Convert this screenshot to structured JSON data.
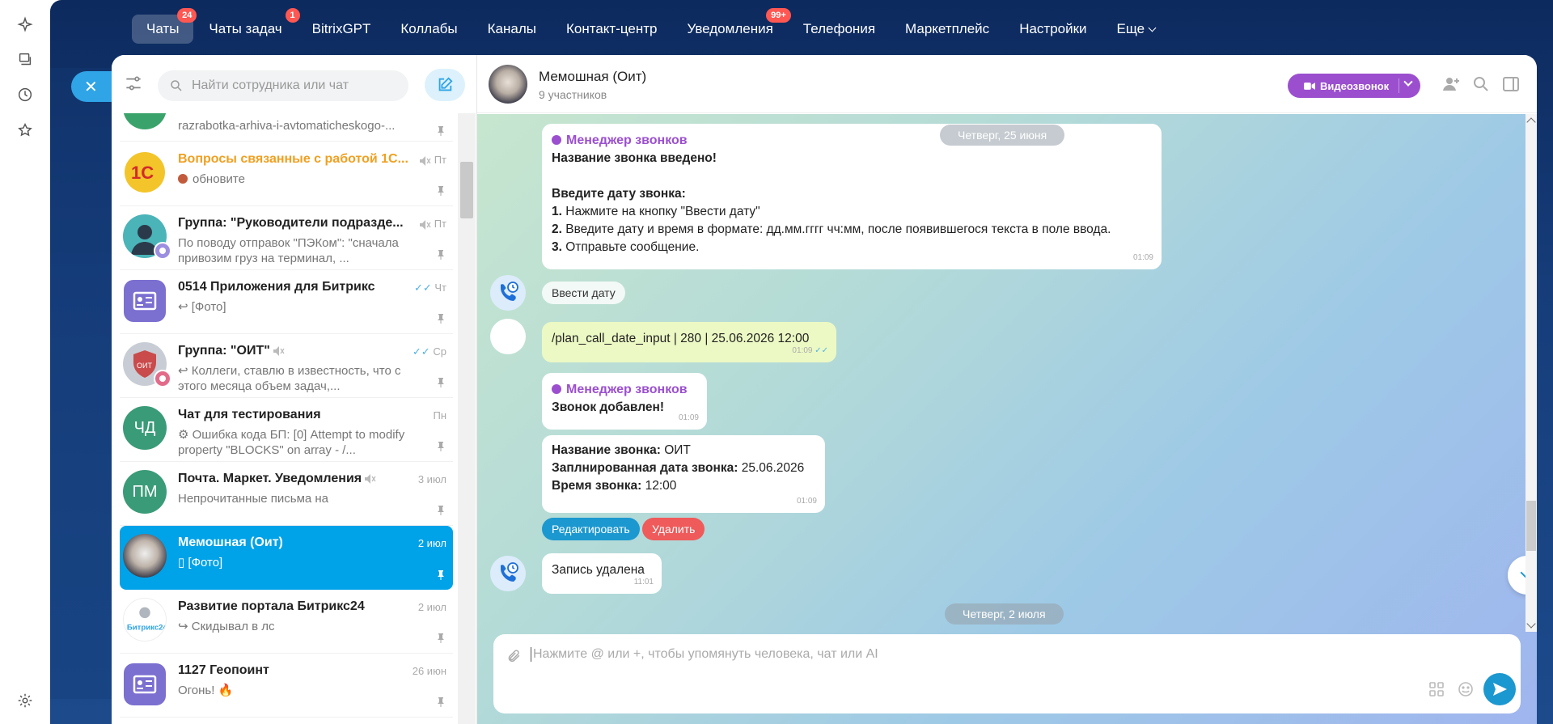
{
  "nav": {
    "items": [
      {
        "label": "Чаты",
        "badge": "24",
        "active": true
      },
      {
        "label": "Чаты задач",
        "badge": "1"
      },
      {
        "label": "BitrixGPT"
      },
      {
        "label": "Коллабы"
      },
      {
        "label": "Каналы"
      },
      {
        "label": "Контакт-центр"
      },
      {
        "label": "Уведомления",
        "badge": "99+"
      },
      {
        "label": "Телефония"
      },
      {
        "label": "Маркетплейс"
      },
      {
        "label": "Настройки"
      },
      {
        "label": "Еще"
      }
    ]
  },
  "rail": {
    "icons": [
      "sparkle-icon",
      "layers-icon",
      "clock-icon",
      "star-icon",
      "gear-icon"
    ]
  },
  "sidebar": {
    "search_placeholder": "Найти сотрудника или чат",
    "chats": [
      {
        "title": "",
        "preview": "razrabotka-arhiva-i-avtomaticheskogo-...",
        "time": "",
        "avatar_color": "#3aa36b"
      },
      {
        "title": "Вопросы связанные с работой 1С...",
        "preview": "обновите",
        "time": "Пт",
        "title_color": "#f0a020",
        "avatar_label": "1С",
        "avatar_color": "#e9c03a",
        "muted": true
      },
      {
        "title": "Группа: \"Руководители подразде...",
        "preview": "По поводу отправок \"ПЭКом\": \"сначала привозим груз на терминал, ...",
        "time": "Пт",
        "avatar_color": "#4ab4b8",
        "muted": true
      },
      {
        "title": "0514 Приложения для Битрикс",
        "preview": "[Фото]",
        "time": "Чт",
        "avatar_color": "#7b6fd0"
      },
      {
        "title": "Группа: \"ОИТ\"",
        "preview": "Коллеги, ставлю в известность, что с этого месяца объем задач,...",
        "time": "Ср",
        "avatar_color": "#c95050",
        "muted": true
      },
      {
        "title": "Чат для тестирования",
        "preview": "Ошибка кода БП: [0] Attempt to modify property \"BLOCKS\" on array - /...",
        "time": "Пн",
        "avatar_label": "ЧД",
        "avatar_color": "#3a9b78"
      },
      {
        "title": "Почта. Маркет. Уведомления",
        "preview": "Непрочитанные письма на",
        "time": "3 июл",
        "avatar_label": "ПМ",
        "avatar_color": "#3a9b78",
        "muted": true
      },
      {
        "title": "Мемошная (Оит)",
        "preview": "[Фото]",
        "time": "2 июл",
        "selected": true
      },
      {
        "title": "Развитие портала Битрикс24",
        "preview": "Скидывал в лс",
        "time": "2 июл",
        "avatar_label": "Битрикс24",
        "avatar_color": "#ffffff"
      },
      {
        "title": "1127 Геопоинт",
        "preview": "Огонь! 🔥",
        "time": "26 июн",
        "avatar_color": "#7b6fd0"
      }
    ]
  },
  "chat": {
    "title": "Мемошная (Оит)",
    "subtitle": "9 участников",
    "video_label": "Видеозвонок",
    "date_1": "Четверг, 25 июня",
    "date_2": "Четверг, 2 июля",
    "m1": {
      "sender": "Менеджер звонков",
      "line1": "Название звонка введено!",
      "line2": "Введите дату звонка:",
      "step1_num": "1.",
      "step1": "Нажмите на кнопку \"Ввести дату\"",
      "step2_num": "2.",
      "step2": "Введите дату и время в формате: дд.мм.гггг чч:мм, после появившегося текста в поле ввода.",
      "step3_num": "3.",
      "step3": "Отправьте сообщение.",
      "time": "01:09"
    },
    "btn_enter_date": "Ввести дату",
    "m2": {
      "text": "/plan_call_date_input | 280 | 25.06.2026 12:00",
      "time": "01:09"
    },
    "m3": {
      "sender": "Менеджер звонков",
      "text": "Звонок добавлен!",
      "time": "01:09"
    },
    "m4": {
      "k1": "Название звонка:",
      "v1": "ОИТ",
      "k2": "Заплнированная дата звонка:",
      "v2": "25.06.2026",
      "k3": "Время звонка:",
      "v3": "12:00",
      "time": "01:09"
    },
    "btn_edit": "Редактировать",
    "btn_delete": "Удалить",
    "m5": {
      "text": "Запись удалена",
      "time": "11:01"
    },
    "composer_placeholder": "Нажмите @ или +, чтобы упомянуть человека, чат или AI"
  },
  "colors": {
    "accent": "#1b98cf",
    "video": "#9b4fcf",
    "danger": "#ef5a5a",
    "selected": "#00a2e8"
  }
}
